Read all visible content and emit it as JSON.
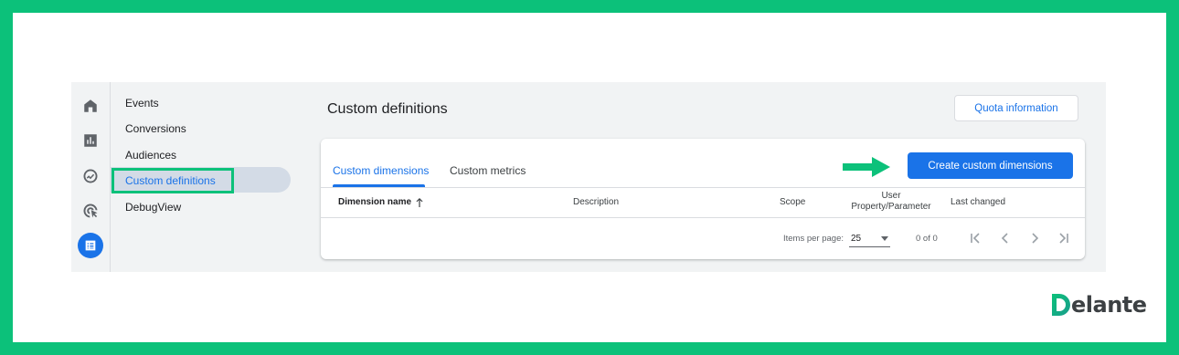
{
  "brand": {
    "logo_rest": "elante",
    "logo_full": "Delante",
    "frame_color": "#0cc17a",
    "accent_color": "#1a73e8"
  },
  "rail": {
    "icons": [
      "home-icon",
      "reports-icon",
      "explore-icon",
      "advertising-icon",
      "configure-icon"
    ]
  },
  "subnav": {
    "items": [
      {
        "label": "Events"
      },
      {
        "label": "Conversions"
      },
      {
        "label": "Audiences"
      },
      {
        "label": "Custom definitions",
        "active": true
      },
      {
        "label": "DebugView"
      }
    ]
  },
  "main": {
    "title": "Custom definitions",
    "quota_button": "Quota information",
    "tabs": [
      {
        "label": "Custom dimensions",
        "active": true
      },
      {
        "label": "Custom metrics"
      }
    ],
    "create_button": "Create custom dimensions",
    "table": {
      "columns": [
        "Dimension name",
        "Description",
        "Scope",
        "User Property/Parameter",
        "Last changed"
      ],
      "user_col_line1": "User",
      "user_col_line2": "Property/Parameter",
      "rows": []
    },
    "pagination": {
      "items_per_page_label": "Items per page:",
      "items_per_page_value": "25",
      "range": "0 of 0"
    }
  }
}
